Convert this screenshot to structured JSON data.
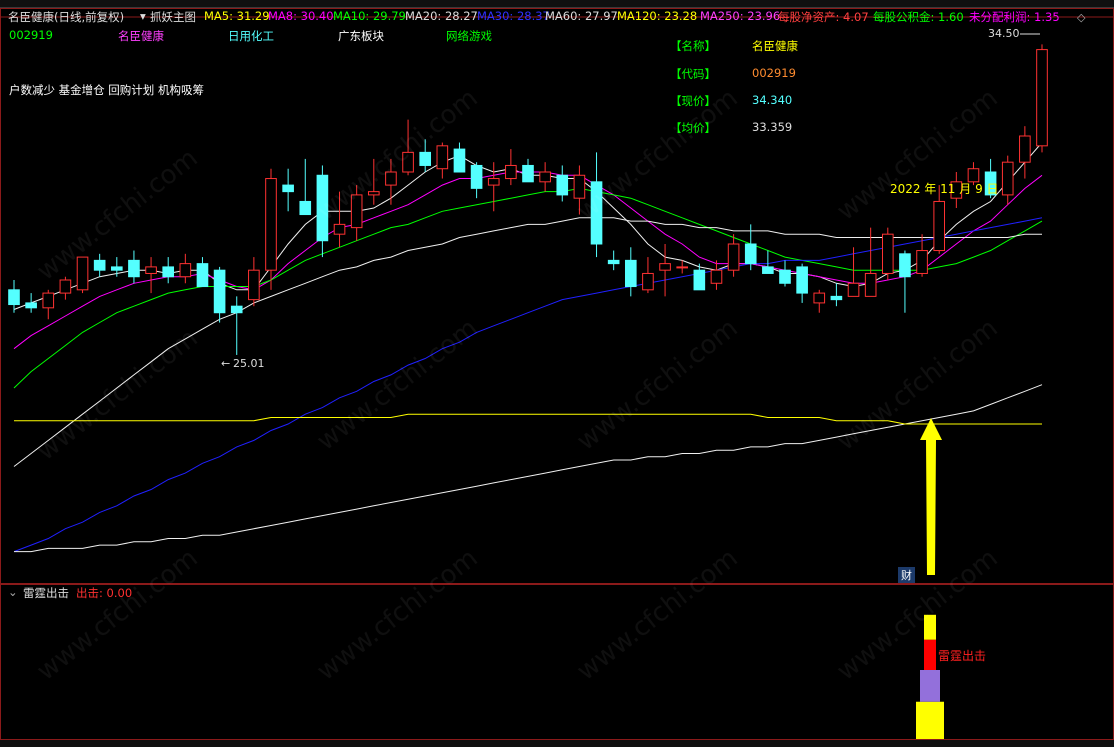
{
  "header": {
    "stock_title": "名臣健康(日线,前复权)",
    "indicator_name": "抓妖主图",
    "ma_items": [
      {
        "label": "MA5: 31.29",
        "color": "#ffff00"
      },
      {
        "label": "MA8: 30.40",
        "color": "#ff00ff"
      },
      {
        "label": "MA10: 29.79",
        "color": "#00ff00"
      },
      {
        "label": "MA20: 28.27",
        "color": "#dddddd"
      },
      {
        "label": "MA30: 28.37",
        "color": "#3030ff"
      },
      {
        "label": "MA60: 27.97",
        "color": "#dddddd"
      },
      {
        "label": "MA120: 23.28",
        "color": "#ffff00"
      },
      {
        "label": "MA250: 23.96",
        "color": "#ff40ff"
      },
      {
        "label": "每股净资产: 4.07",
        "color": "#ff4040"
      },
      {
        "label": "每股公积金: 1.60",
        "color": "#00ff00"
      },
      {
        "label": "未分配利润: 1.35",
        "color": "#ff00ff"
      }
    ]
  },
  "tags": {
    "code": "002919",
    "name": "名臣健康",
    "industry": "日用化工",
    "region": "广东板块",
    "concept": "网络游戏",
    "flags": "户数减少 基金增仓 回购计划 机构吸筹"
  },
  "info": {
    "name_label": "【名称】",
    "name_value": "名臣健康",
    "code_label": "【代码】",
    "code_value": "002919",
    "price_label": "【现价】",
    "price_value": "34.340",
    "avg_label": "【均价】",
    "avg_value": "33.359"
  },
  "annotations": {
    "high_label": "34.50",
    "low_label": "25.01",
    "date_label": "2022 年 11 月 9 日",
    "fin_marker": "财",
    "signal_label": "雷霆出击"
  },
  "sub_panel": {
    "title": "雷霆出击",
    "output": "出击: 0.00"
  },
  "colors": {
    "up": "#ff3232",
    "down": "#54ffff",
    "frame": "#8b1a1a",
    "arrow": "#ffff00"
  },
  "chart_data": {
    "type": "candlestick",
    "price_range": [
      24,
      35
    ],
    "candles": [
      {
        "o": 27.0,
        "h": 27.3,
        "l": 26.3,
        "c": 26.55
      },
      {
        "o": 26.6,
        "h": 26.9,
        "l": 26.3,
        "c": 26.45
      },
      {
        "o": 26.45,
        "h": 27.0,
        "l": 26.1,
        "c": 26.9
      },
      {
        "o": 26.9,
        "h": 27.4,
        "l": 26.7,
        "c": 27.3
      },
      {
        "o": 27.0,
        "h": 28.0,
        "l": 26.9,
        "c": 28.0
      },
      {
        "o": 27.9,
        "h": 28.1,
        "l": 27.4,
        "c": 27.6
      },
      {
        "o": 27.7,
        "h": 28.0,
        "l": 27.4,
        "c": 27.6
      },
      {
        "o": 27.9,
        "h": 28.2,
        "l": 27.2,
        "c": 27.4
      },
      {
        "o": 27.5,
        "h": 28.0,
        "l": 26.9,
        "c": 27.7
      },
      {
        "o": 27.7,
        "h": 28.0,
        "l": 27.2,
        "c": 27.4
      },
      {
        "o": 27.4,
        "h": 28.1,
        "l": 27.2,
        "c": 27.8
      },
      {
        "o": 27.8,
        "h": 28.0,
        "l": 27.1,
        "c": 27.1
      },
      {
        "o": 27.6,
        "h": 27.7,
        "l": 26.0,
        "c": 26.3
      },
      {
        "o": 26.5,
        "h": 26.8,
        "l": 25.01,
        "c": 26.3
      },
      {
        "o": 26.7,
        "h": 28.0,
        "l": 26.5,
        "c": 27.6
      },
      {
        "o": 27.6,
        "h": 30.7,
        "l": 27.0,
        "c": 30.4
      },
      {
        "o": 30.2,
        "h": 30.7,
        "l": 29.4,
        "c": 30.0
      },
      {
        "o": 29.7,
        "h": 31.0,
        "l": 29.3,
        "c": 29.3
      },
      {
        "o": 30.5,
        "h": 30.8,
        "l": 28.0,
        "c": 28.5
      },
      {
        "o": 28.7,
        "h": 30.0,
        "l": 28.3,
        "c": 29.0
      },
      {
        "o": 28.9,
        "h": 30.2,
        "l": 28.5,
        "c": 29.9
      },
      {
        "o": 29.9,
        "h": 31.0,
        "l": 29.6,
        "c": 30.0
      },
      {
        "o": 30.2,
        "h": 31.0,
        "l": 29.6,
        "c": 30.6
      },
      {
        "o": 30.6,
        "h": 32.2,
        "l": 30.5,
        "c": 31.2
      },
      {
        "o": 31.2,
        "h": 31.6,
        "l": 30.6,
        "c": 30.8
      },
      {
        "o": 30.7,
        "h": 31.5,
        "l": 30.4,
        "c": 31.4
      },
      {
        "o": 31.3,
        "h": 31.5,
        "l": 30.6,
        "c": 30.6
      },
      {
        "o": 30.8,
        "h": 30.9,
        "l": 29.8,
        "c": 30.1
      },
      {
        "o": 30.2,
        "h": 30.9,
        "l": 29.4,
        "c": 30.4
      },
      {
        "o": 30.4,
        "h": 31.3,
        "l": 30.2,
        "c": 30.8
      },
      {
        "o": 30.8,
        "h": 31.0,
        "l": 30.3,
        "c": 30.3
      },
      {
        "o": 30.3,
        "h": 30.9,
        "l": 30.0,
        "c": 30.6
      },
      {
        "o": 30.5,
        "h": 30.8,
        "l": 29.7,
        "c": 29.9
      },
      {
        "o": 29.8,
        "h": 30.8,
        "l": 29.3,
        "c": 30.5
      },
      {
        "o": 30.3,
        "h": 31.2,
        "l": 28.0,
        "c": 28.4
      },
      {
        "o": 27.9,
        "h": 28.2,
        "l": 27.6,
        "c": 27.8
      },
      {
        "o": 27.9,
        "h": 28.3,
        "l": 26.8,
        "c": 27.1
      },
      {
        "o": 27.0,
        "h": 28.0,
        "l": 26.9,
        "c": 27.5
      },
      {
        "o": 27.6,
        "h": 28.4,
        "l": 26.8,
        "c": 27.8
      },
      {
        "o": 27.7,
        "h": 27.9,
        "l": 27.5,
        "c": 27.7
      },
      {
        "o": 27.6,
        "h": 27.8,
        "l": 27.0,
        "c": 27.0
      },
      {
        "o": 27.2,
        "h": 27.9,
        "l": 27.0,
        "c": 27.6
      },
      {
        "o": 27.6,
        "h": 28.7,
        "l": 27.4,
        "c": 28.4
      },
      {
        "o": 28.4,
        "h": 29.0,
        "l": 27.6,
        "c": 27.8
      },
      {
        "o": 27.7,
        "h": 28.2,
        "l": 27.5,
        "c": 27.5
      },
      {
        "o": 27.6,
        "h": 27.9,
        "l": 27.1,
        "c": 27.2
      },
      {
        "o": 27.7,
        "h": 27.8,
        "l": 26.6,
        "c": 26.9
      },
      {
        "o": 26.6,
        "h": 27.0,
        "l": 26.3,
        "c": 26.9
      },
      {
        "o": 26.8,
        "h": 27.2,
        "l": 26.5,
        "c": 26.7
      },
      {
        "o": 26.8,
        "h": 28.3,
        "l": 26.9,
        "c": 27.2
      },
      {
        "o": 26.8,
        "h": 28.9,
        "l": 26.8,
        "c": 27.5
      },
      {
        "o": 27.5,
        "h": 28.9,
        "l": 27.3,
        "c": 28.7
      },
      {
        "o": 28.1,
        "h": 28.2,
        "l": 26.3,
        "c": 27.4
      },
      {
        "o": 27.5,
        "h": 28.7,
        "l": 27.4,
        "c": 28.2
      },
      {
        "o": 28.2,
        "h": 30.2,
        "l": 28.1,
        "c": 29.7
      },
      {
        "o": 29.8,
        "h": 30.6,
        "l": 29.5,
        "c": 30.3
      },
      {
        "o": 30.3,
        "h": 30.9,
        "l": 30.2,
        "c": 30.7
      },
      {
        "o": 30.6,
        "h": 31.0,
        "l": 29.8,
        "c": 29.9
      },
      {
        "o": 29.9,
        "h": 31.1,
        "l": 29.6,
        "c": 30.9
      },
      {
        "o": 30.9,
        "h": 32.0,
        "l": 30.4,
        "c": 31.7
      },
      {
        "o": 31.4,
        "h": 34.5,
        "l": 31.2,
        "c": 34.34
      }
    ],
    "ma_series": [
      {
        "name": "MA5",
        "color": "#f0f0f0",
        "values": [
          26.4,
          26.6,
          26.8,
          27.0,
          27.2,
          27.4,
          27.5,
          27.6,
          27.6,
          27.5,
          27.6,
          27.6,
          27.2,
          27.0,
          27.0,
          27.7,
          28.4,
          29.0,
          29.4,
          29.4,
          29.4,
          29.5,
          29.8,
          30.2,
          30.6,
          30.9,
          31.1,
          30.8,
          30.6,
          30.7,
          30.5,
          30.5,
          30.4,
          30.4,
          30.0,
          29.5,
          29.0,
          28.4,
          28.0,
          27.9,
          27.7,
          27.6,
          27.8,
          27.8,
          27.7,
          27.5,
          27.5,
          27.4,
          27.2,
          27.1,
          27.2,
          27.5,
          27.6,
          27.9,
          28.5,
          29.0,
          29.4,
          29.7,
          30.3,
          30.9,
          31.5
        ]
      },
      {
        "name": "MA8",
        "color": "#ff00ff",
        "values": [
          25.2,
          25.6,
          25.9,
          26.2,
          26.5,
          26.8,
          27.0,
          27.2,
          27.3,
          27.4,
          27.4,
          27.5,
          27.3,
          27.1,
          27.0,
          27.3,
          27.8,
          28.2,
          28.6,
          28.9,
          29.0,
          29.2,
          29.4,
          29.6,
          29.9,
          30.2,
          30.4,
          30.4,
          30.5,
          30.6,
          30.6,
          30.6,
          30.5,
          30.5,
          30.2,
          29.9,
          29.5,
          29.1,
          28.7,
          28.4,
          28.0,
          27.8,
          27.8,
          27.8,
          27.7,
          27.6,
          27.5,
          27.4,
          27.3,
          27.2,
          27.2,
          27.3,
          27.4,
          27.6,
          28.0,
          28.4,
          28.8,
          29.1,
          29.6,
          30.1,
          30.5
        ]
      },
      {
        "name": "MA10",
        "color": "#00ff00",
        "values": [
          24.0,
          24.5,
          24.9,
          25.3,
          25.7,
          26.0,
          26.3,
          26.5,
          26.7,
          26.9,
          27.0,
          27.1,
          27.1,
          27.1,
          27.1,
          27.3,
          27.6,
          27.9,
          28.1,
          28.3,
          28.5,
          28.7,
          28.9,
          29.0,
          29.2,
          29.4,
          29.5,
          29.6,
          29.7,
          29.8,
          29.9,
          30.0,
          30.0,
          30.1,
          30.0,
          29.9,
          29.8,
          29.6,
          29.4,
          29.2,
          29.0,
          28.8,
          28.6,
          28.4,
          28.2,
          28.0,
          27.9,
          27.8,
          27.7,
          27.6,
          27.6,
          27.6,
          27.6,
          27.6,
          27.7,
          27.8,
          28.0,
          28.2,
          28.5,
          28.8,
          29.1
        ]
      },
      {
        "name": "MA20",
        "color": "#f0f0f0",
        "values": [
          21.6,
          22.0,
          22.4,
          22.8,
          23.2,
          23.6,
          24.0,
          24.4,
          24.8,
          25.2,
          25.5,
          25.8,
          26.1,
          26.3,
          26.6,
          26.8,
          27.0,
          27.2,
          27.4,
          27.6,
          27.7,
          27.9,
          28.0,
          28.2,
          28.3,
          28.4,
          28.6,
          28.7,
          28.8,
          28.9,
          29.0,
          29.0,
          29.1,
          29.2,
          29.2,
          29.2,
          29.1,
          29.1,
          29.0,
          29.0,
          28.9,
          28.9,
          28.8,
          28.8,
          28.8,
          28.7,
          28.7,
          28.7,
          28.6,
          28.6,
          28.6,
          28.6,
          28.6,
          28.6,
          28.6,
          28.6,
          28.6,
          28.6,
          28.6,
          28.7,
          28.7
        ]
      },
      {
        "name": "MA30",
        "color": "#2020ff",
        "values": [
          19.0,
          19.2,
          19.4,
          19.7,
          19.9,
          20.2,
          20.4,
          20.7,
          20.9,
          21.2,
          21.4,
          21.7,
          21.9,
          22.2,
          22.4,
          22.7,
          22.9,
          23.2,
          23.4,
          23.7,
          23.9,
          24.2,
          24.4,
          24.7,
          24.9,
          25.2,
          25.4,
          25.7,
          25.9,
          26.1,
          26.3,
          26.5,
          26.7,
          26.8,
          26.9,
          27.0,
          27.1,
          27.2,
          27.3,
          27.4,
          27.5,
          27.6,
          27.7,
          27.8,
          27.8,
          27.9,
          27.9,
          27.9,
          28.0,
          28.1,
          28.2,
          28.3,
          28.4,
          28.5,
          28.6,
          28.7,
          28.8,
          28.9,
          29.0,
          29.1,
          29.2
        ]
      },
      {
        "name": "MA60",
        "color": "#f0f0f0",
        "values": [
          19.0,
          19.0,
          19.1,
          19.1,
          19.1,
          19.2,
          19.2,
          19.3,
          19.3,
          19.4,
          19.4,
          19.5,
          19.5,
          19.6,
          19.7,
          19.8,
          19.9,
          20.0,
          20.1,
          20.2,
          20.3,
          20.4,
          20.5,
          20.6,
          20.7,
          20.8,
          20.9,
          21.0,
          21.1,
          21.2,
          21.3,
          21.4,
          21.5,
          21.6,
          21.7,
          21.8,
          21.8,
          21.9,
          21.9,
          22.0,
          22.0,
          22.1,
          22.1,
          22.2,
          22.2,
          22.3,
          22.3,
          22.4,
          22.5,
          22.6,
          22.7,
          22.8,
          22.9,
          23.0,
          23.1,
          23.2,
          23.3,
          23.5,
          23.7,
          23.9,
          24.1
        ]
      },
      {
        "name": "MA120",
        "color": "#ffff00",
        "values": [
          23.0,
          23.0,
          23.0,
          23.0,
          23.0,
          23.0,
          23.0,
          23.0,
          23.0,
          23.0,
          23.0,
          23.0,
          23.0,
          23.0,
          23.0,
          23.1,
          23.1,
          23.1,
          23.1,
          23.1,
          23.1,
          23.1,
          23.1,
          23.2,
          23.2,
          23.2,
          23.2,
          23.2,
          23.2,
          23.2,
          23.2,
          23.2,
          23.2,
          23.2,
          23.2,
          23.2,
          23.2,
          23.2,
          23.2,
          23.2,
          23.2,
          23.2,
          23.2,
          23.2,
          23.1,
          23.1,
          23.1,
          23.1,
          23.0,
          23.0,
          23.0,
          23.0,
          22.9,
          22.9,
          22.9,
          22.9,
          22.9,
          22.9,
          22.9,
          22.9,
          22.9
        ]
      }
    ],
    "sub_bars": [
      {
        "value": 0.9,
        "color": "#ffff00"
      },
      {
        "value": 0.75,
        "color": "#9370db"
      },
      {
        "value": 0.55,
        "color": "#ff0000"
      },
      {
        "value": 0.38,
        "color": "#ffff00"
      }
    ]
  }
}
